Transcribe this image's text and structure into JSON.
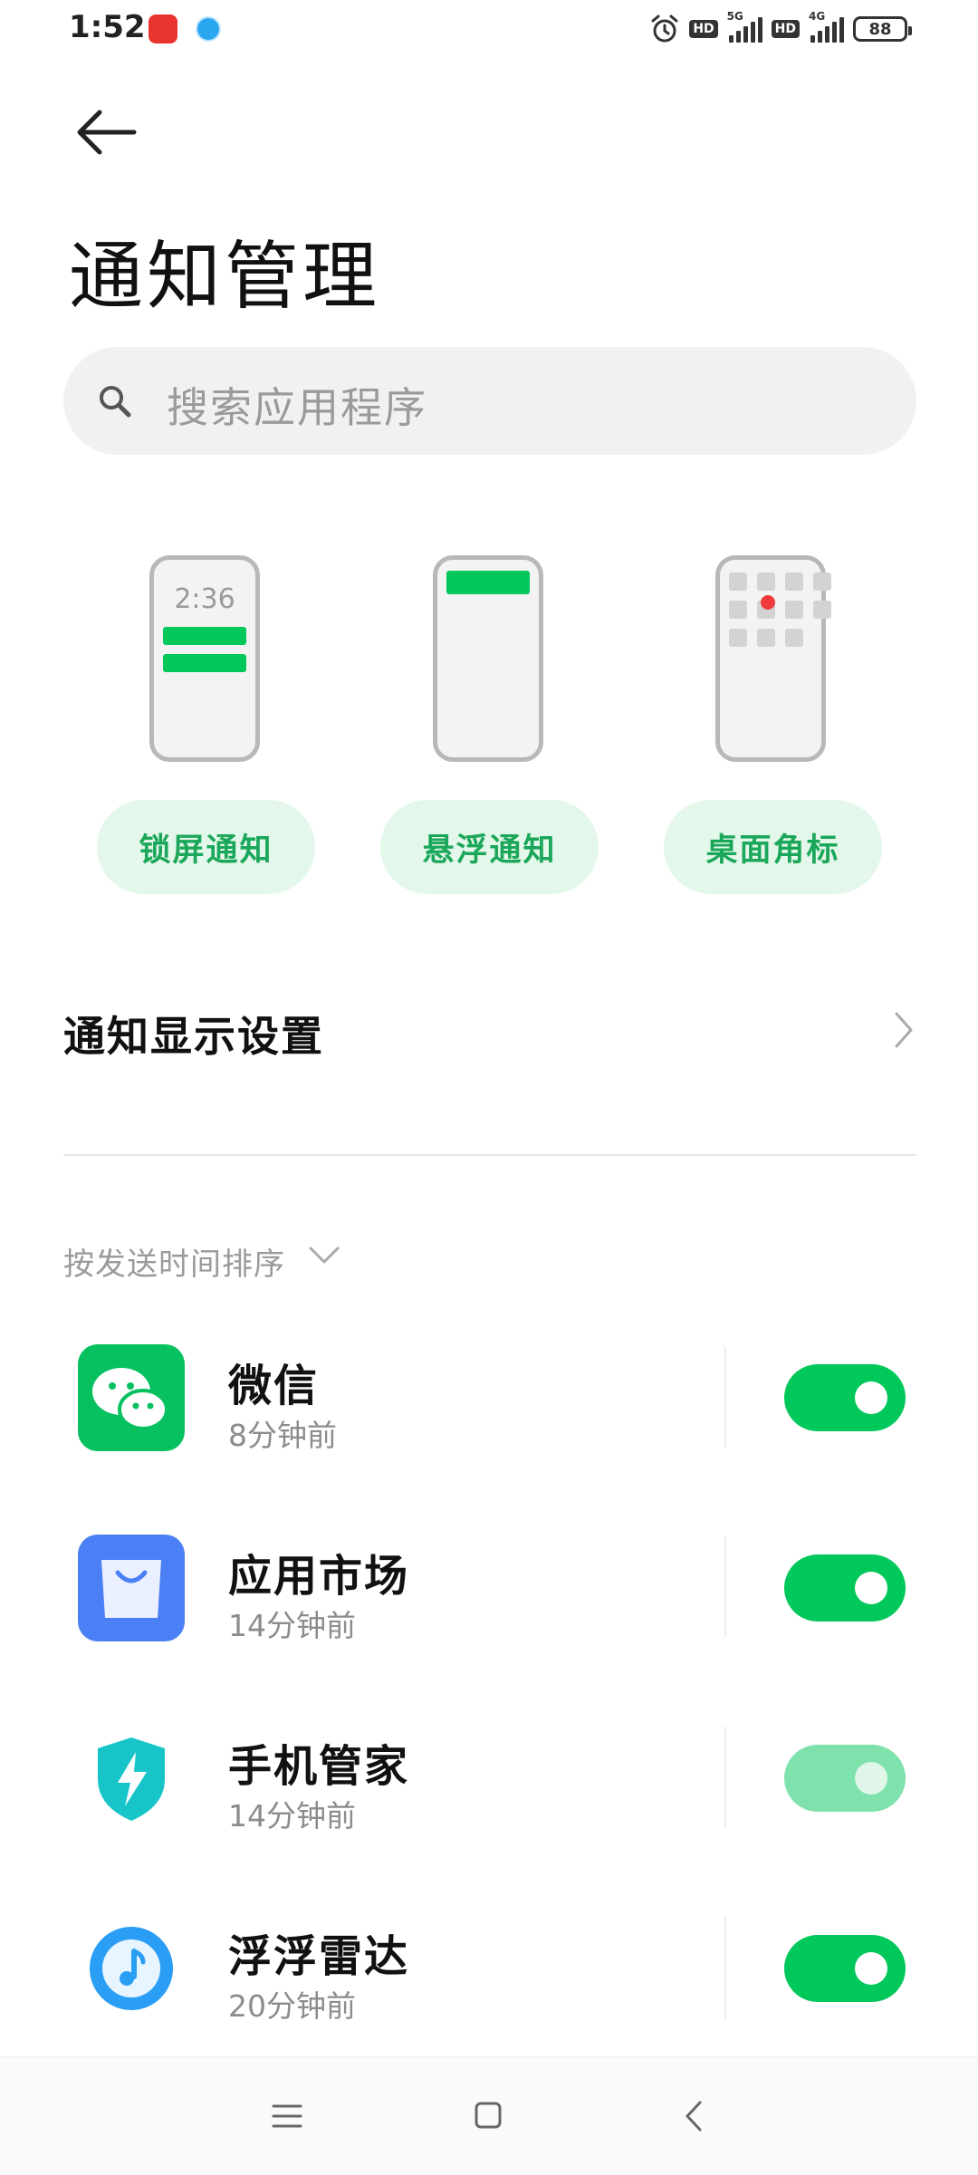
{
  "status_bar": {
    "time": "1:52",
    "net1": "5G",
    "net2": "4G",
    "hd": "HD",
    "battery": "88"
  },
  "header": {
    "title": "通知管理"
  },
  "search": {
    "placeholder": "搜索应用程序"
  },
  "styles": [
    {
      "label": "锁屏通知",
      "preview_time": "2:36"
    },
    {
      "label": "悬浮通知"
    },
    {
      "label": "桌面角标"
    }
  ],
  "settings": {
    "display_label": "通知显示设置"
  },
  "sort": {
    "label": "按发送时间排序"
  },
  "apps": [
    {
      "name": "微信",
      "time": "8分钟前",
      "enabled": true
    },
    {
      "name": "应用市场",
      "time": "14分钟前",
      "enabled": true
    },
    {
      "name": "手机管家",
      "time": "14分钟前",
      "enabled": true,
      "disabled_style": true
    },
    {
      "name": "浮浮雷达",
      "time": "20分钟前",
      "enabled": true
    }
  ],
  "colors": {
    "accent": "#00c85a",
    "pill_bg": "#e3f7ea",
    "pill_text": "#1ba75a"
  }
}
